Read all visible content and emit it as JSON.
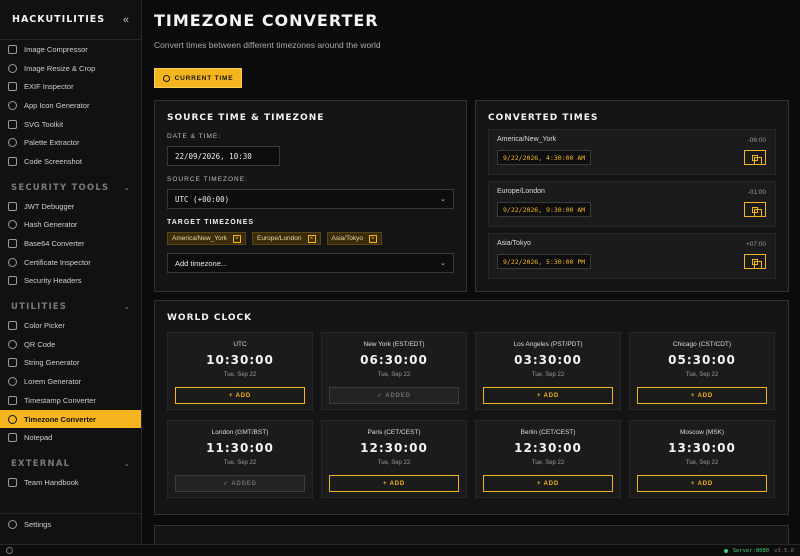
{
  "app": {
    "brand": "HACKUTILITIES",
    "accent": "#f5b51f"
  },
  "sidebar": {
    "top_items": [
      {
        "label": "Image Compressor",
        "icon": "image-icon"
      },
      {
        "label": "Image Resize & Crop",
        "icon": "crop-icon"
      },
      {
        "label": "EXIF Inspector",
        "icon": "camera-icon"
      },
      {
        "label": "App Icon Generator",
        "icon": "app-icon"
      },
      {
        "label": "SVG Toolkit",
        "icon": "pen-icon"
      },
      {
        "label": "Palette Extractor",
        "icon": "palette-icon"
      },
      {
        "label": "Code Screenshot",
        "icon": "camera-icon"
      }
    ],
    "security_title": "SECURITY TOOLS",
    "security_items": [
      {
        "label": "JWT Debugger",
        "icon": "key-icon"
      },
      {
        "label": "Hash Generator",
        "icon": "hash-icon"
      },
      {
        "label": "Base64 Converter",
        "icon": "swap-icon"
      },
      {
        "label": "Certificate Inspector",
        "icon": "certificate-icon"
      },
      {
        "label": "Security Headers",
        "icon": "shield-icon"
      }
    ],
    "utilities_title": "UTILITIES",
    "utility_items": [
      {
        "label": "Color Picker",
        "icon": "color-icon"
      },
      {
        "label": "QR Code",
        "icon": "qr-icon"
      },
      {
        "label": "String Generator",
        "icon": "text-icon"
      },
      {
        "label": "Lorem Generator",
        "icon": "document-icon"
      },
      {
        "label": "Timestamp Converter",
        "icon": "clock-icon"
      },
      {
        "label": "Timezone Converter",
        "icon": "globe-icon",
        "active": true
      },
      {
        "label": "Notepad",
        "icon": "notepad-icon"
      }
    ],
    "external_title": "EXTERNAL",
    "external_items": [
      {
        "label": "Team Handbook",
        "icon": "handbook-icon"
      }
    ],
    "settings_label": "Settings"
  },
  "page": {
    "title": "TIMEZONE CONVERTER",
    "subtitle": "Convert times between different timezones around the world",
    "current_time_label": "CURRENT TIME"
  },
  "source": {
    "title": "SOURCE TIME & TIMEZONE",
    "datetime_label": "DATE & TIME:",
    "datetime_value": "22/09/2026, 10:30",
    "tz_label": "SOURCE TIMEZONE:",
    "tz_value": "UTC (+00:00)",
    "targets_label": "TARGET TIMEZONES",
    "targets": [
      "America/New_York",
      "Europe/London",
      "Asia/Tokyo"
    ],
    "remove_glyph": "×",
    "add_placeholder": "Add timezone..."
  },
  "converted": {
    "title": "CONVERTED TIMES",
    "items": [
      {
        "tz": "America/New_York",
        "offset": "-06:00",
        "time": "9/22/2026, 4:30:00 AM"
      },
      {
        "tz": "Europe/London",
        "offset": "-01:00",
        "time": "9/22/2026, 9:30:00 AM"
      },
      {
        "tz": "Asia/Tokyo",
        "offset": "+07:00",
        "time": "9/22/2026, 5:30:00 PM"
      }
    ]
  },
  "world": {
    "title": "WORLD CLOCK",
    "clocks": [
      {
        "city": "UTC",
        "time": "10:30:00",
        "date": "Tue, Sep 22",
        "button": "+ ADD",
        "added": false
      },
      {
        "city": "New York (EST/EDT)",
        "time": "06:30:00",
        "date": "Tue, Sep 22",
        "button": "✓ ADDED",
        "added": true
      },
      {
        "city": "Los Angeles (PST/PDT)",
        "time": "03:30:00",
        "date": "Tue, Sep 22",
        "button": "+ ADD",
        "added": false
      },
      {
        "city": "Chicago (CST/CDT)",
        "time": "05:30:00",
        "date": "Tue, Sep 22",
        "button": "+ ADD",
        "added": false
      },
      {
        "city": "London (GMT/BST)",
        "time": "11:30:00",
        "date": "Tue, Sep 22",
        "button": "✓ ADDED",
        "added": true
      },
      {
        "city": "Paris (CET/CEST)",
        "time": "12:30:00",
        "date": "Tue, Sep 22",
        "button": "+ ADD",
        "added": false
      },
      {
        "city": "Berlin (CET/CEST)",
        "time": "12:30:00",
        "date": "Tue, Sep 22",
        "button": "+ ADD",
        "added": false
      },
      {
        "city": "Moscow (MSK)",
        "time": "13:30:00",
        "date": "Tue, Sep 22",
        "button": "+ ADD",
        "added": false
      }
    ]
  },
  "status": {
    "server": "Server:8080",
    "version": "v3.5.0"
  }
}
